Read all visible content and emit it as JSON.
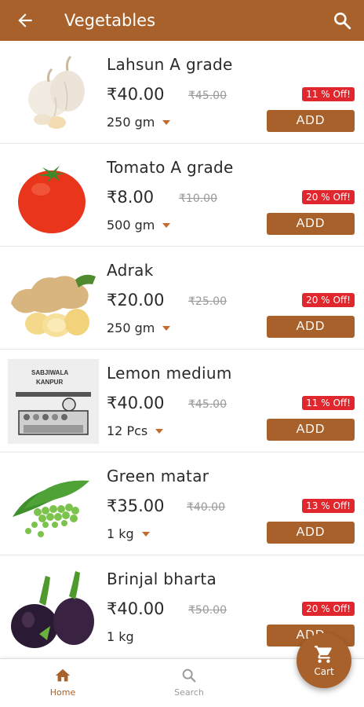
{
  "header": {
    "title": "Vegetables",
    "back_icon": "arrow-back-icon",
    "search_icon": "search-icon"
  },
  "colors": {
    "primary": "#a8612b",
    "discount": "#e0272d"
  },
  "products": [
    {
      "name": "Lahsun A grade",
      "price": "₹40.00",
      "mrp": "₹45.00",
      "discount": "11 % Off!",
      "qty": "250 gm",
      "add": "ADD",
      "image": "garlic"
    },
    {
      "name": "Tomato A grade",
      "price": "₹8.00",
      "mrp": "₹10.00",
      "discount": "20 % Off!",
      "qty": "500 gm",
      "add": "ADD",
      "image": "tomato"
    },
    {
      "name": "Adrak",
      "price": "₹20.00",
      "mrp": "₹25.00",
      "discount": "20 % Off!",
      "qty": "250 gm",
      "add": "ADD",
      "image": "ginger"
    },
    {
      "name": "Lemon medium",
      "price": "₹40.00",
      "mrp": "₹45.00",
      "discount": "11 % Off!",
      "qty": "12 Pcs",
      "add": "ADD",
      "image": "placeholder",
      "image_text": "SABJIWALA KANPUR"
    },
    {
      "name": "Green matar",
      "price": "₹35.00",
      "mrp": "₹40.00",
      "discount": "13 % Off!",
      "qty": "1 kg",
      "add": "ADD",
      "image": "peas"
    },
    {
      "name": "Brinjal bharta",
      "price": "₹40.00",
      "mrp": "₹50.00",
      "discount": "20 % Off!",
      "qty": "1 kg",
      "add": "ADD",
      "image": "brinjal"
    }
  ],
  "bottom_nav": {
    "home": "Home",
    "search": "Search"
  },
  "cart": {
    "label": "Cart"
  }
}
